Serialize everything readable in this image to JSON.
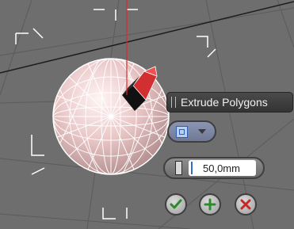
{
  "app": {
    "name": "3D Viewport"
  },
  "viewport": {
    "background_color": "#6e6e6e",
    "grid_color": "#595959",
    "object": "geosphere",
    "object_color": "#e9c6c6",
    "selected_polygon_color": "#e03030"
  },
  "caddy": {
    "title": "Extrude Polygons",
    "mode": {
      "icon": "polygon-group-icon",
      "selected": "group"
    },
    "height": {
      "icon": "extrusion-height-icon",
      "value": "50,0mm"
    },
    "buttons": {
      "ok_icon": "checkmark-icon",
      "apply_icon": "plus-icon",
      "cancel_icon": "cross-icon",
      "ok_color": "#2f8a2f",
      "apply_color": "#2f8a2f",
      "cancel_color": "#c42a2a"
    }
  }
}
